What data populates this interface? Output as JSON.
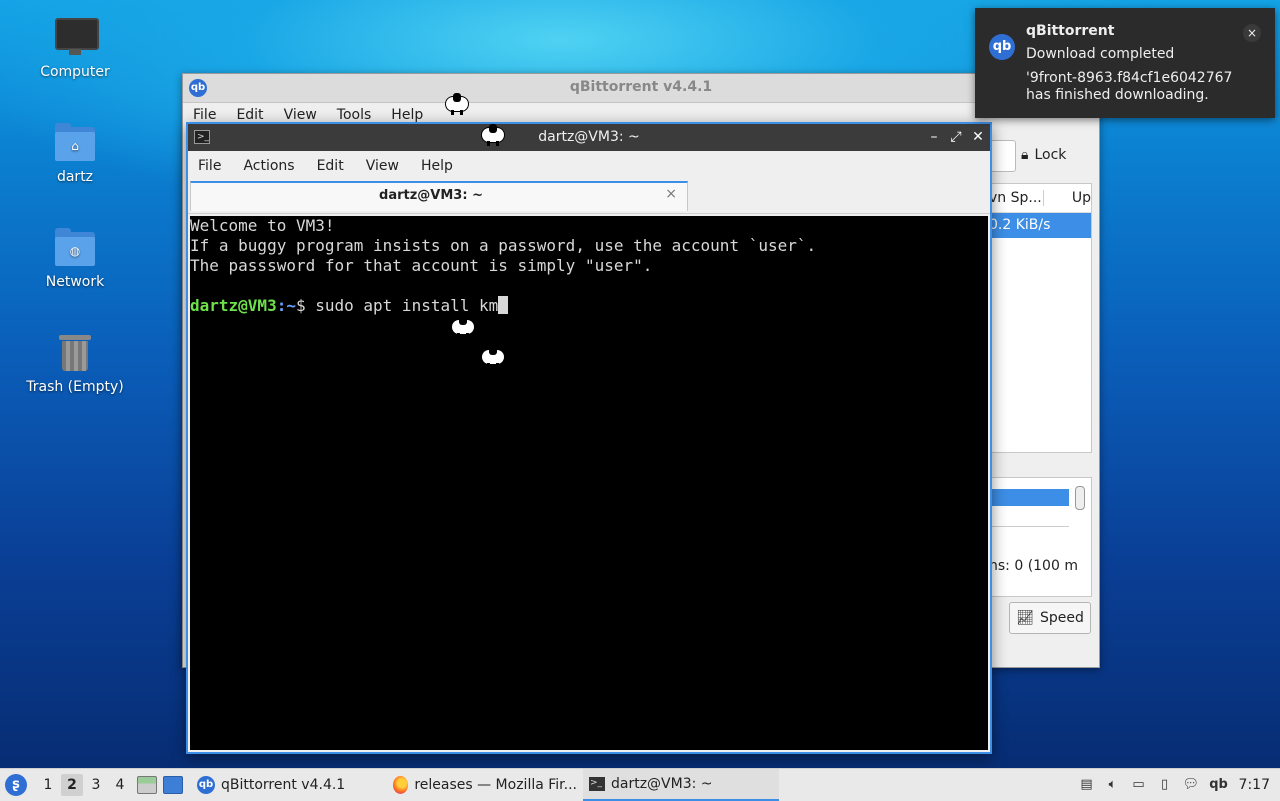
{
  "desktop": {
    "icons": [
      {
        "label": "Computer"
      },
      {
        "label": "dartz"
      },
      {
        "label": "Network"
      },
      {
        "label": "Trash (Empty)"
      }
    ]
  },
  "qbittorrent": {
    "title": "qBittorrent v4.4.1",
    "logo_text": "qb",
    "menu": [
      "File",
      "Edit",
      "View",
      "Tools",
      "Help"
    ],
    "lock_label": "Lock",
    "columns": {
      "down_speed": "vn Sp...",
      "up_speed": "Up"
    },
    "row_down_speed": "0.2 KiB/s",
    "connections_text": "ns: 0 (100 m",
    "speed_button": "Speed"
  },
  "terminal": {
    "title": "dartz@VM3: ~",
    "menu": [
      "File",
      "Actions",
      "Edit",
      "View",
      "Help"
    ],
    "tab_label": "dartz@VM3: ~",
    "lines": [
      "Welcome to VM3!",
      "If a buggy program insists on a password, use the account `user`.",
      "The passsword for that account is simply \"user\"."
    ],
    "prompt_user": "dartz@VM3",
    "prompt_path": ":~",
    "prompt_symbol": "$ ",
    "command": "sudo apt install km"
  },
  "notification": {
    "app": "qBittorrent",
    "summary": "Download completed",
    "body_line1": "'9front-8963.f84cf1e60427675",
    "body_line2": "has finished downloading.",
    "close": "×"
  },
  "taskbar": {
    "workspaces": [
      "1",
      "2",
      "3",
      "4"
    ],
    "active_workspace": "2",
    "tasks": [
      {
        "label": "qBittorrent v4.4.1"
      },
      {
        "label": "releases — Mozilla Fir..."
      },
      {
        "label": "dartz@VM3: ~"
      }
    ],
    "tray_qb": "qb",
    "clock": "7:17"
  },
  "colors": {
    "accent": "#3d8ee6",
    "prompt_user": "#6ee04a",
    "prompt_path": "#6aa0ff"
  }
}
